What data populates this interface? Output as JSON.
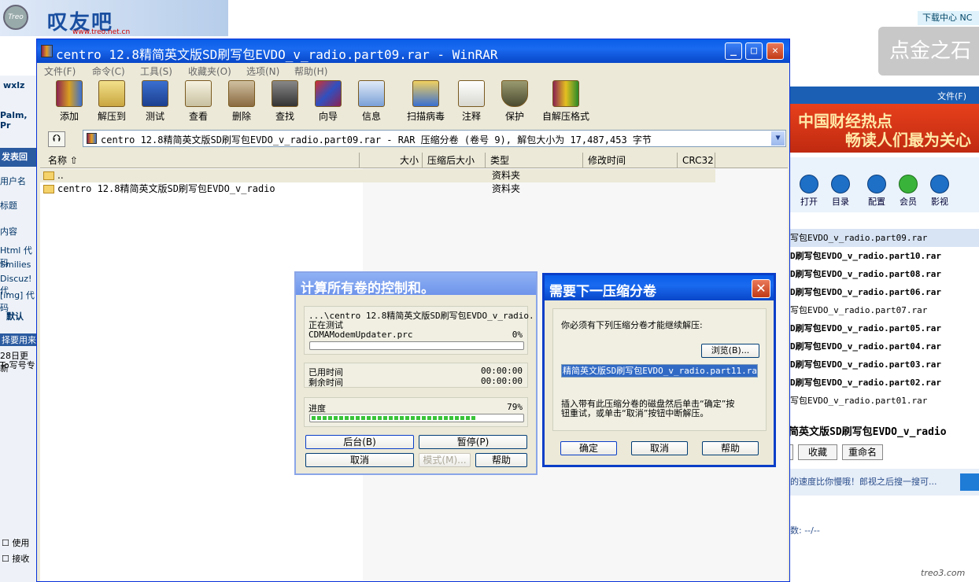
{
  "background": {
    "logo_badge": "Treo",
    "logo_text": "叹友吧",
    "logo_url": "www.treo.net.cn",
    "download_center": "下载中心 NC",
    "gold_stone": "点金之石",
    "left_user": "wxlz",
    "left_palm": "Palm, Pr",
    "left_post": "发表回",
    "left_labels": [
      "用户名",
      "标题",
      "内容",
      "Html 代码",
      "Smilies",
      "Discuz!代",
      "[img] 代码"
    ],
    "left_default": "默认",
    "left_select": "择要用来",
    "left_update": "28日更新",
    "left_write": "To写号专",
    "left_use": "使用",
    "left_receive": "接收",
    "right_file_menu": "文件(F)",
    "right_news": [
      "中国财经热点",
      "畅读人们最为关心"
    ],
    "right_tools": [
      "打开",
      "目录",
      "配置",
      "会员",
      "影视"
    ],
    "right_files": [
      "写包EVDO_v_radio.part09.rar",
      "D刷写包EVDO_v_radio.part10.rar",
      "D刷写包EVDO_v_radio.part08.rar",
      "D刷写包EVDO_v_radio.part06.rar",
      "写包EVDO_v_radio.part07.rar",
      "D刷写包EVDO_v_radio.part05.rar",
      "D刷写包EVDO_v_radio.part04.rar",
      "D刷写包EVDO_v_radio.part03.rar",
      "D刷写包EVDO_v_radio.part02.rar",
      "写包EVDO_v_radio.part01.rar"
    ],
    "right_big_title": "简英文版SD刷写包EVDO_v_radio",
    "right_btn_fav": "收藏",
    "right_btn_rename": "重命名",
    "right_ad": "的速度比你慢哦！郎视之后搜一搜可...",
    "right_count": "数: --/--",
    "watermark": "treo3.com"
  },
  "winrar": {
    "title": "centro 12.8精简英文版SD刷写包EVDO_v_radio.part09.rar - WinRAR",
    "menu": [
      "文件(F)",
      "命令(C)",
      "工具(S)",
      "收藏夹(O)",
      "选项(N)",
      "帮助(H)"
    ],
    "toolbar": [
      "添加",
      "解压到",
      "测试",
      "查看",
      "删除",
      "查找",
      "向导",
      "信息",
      "扫描病毒",
      "注释",
      "保护",
      "自解压格式"
    ],
    "path": "centro 12.8精简英文版SD刷写包EVDO_v_radio.part09.rar - RAR 压缩分卷 (卷号 9), 解包大小为 17,487,453 字节",
    "columns": [
      "名称",
      "大小",
      "压缩后大小",
      "类型",
      "修改时间",
      "CRC32"
    ],
    "rows": [
      {
        "name": "..",
        "type": "资料夹"
      },
      {
        "name": "centro 12.8精简英文版SD刷写包EVDO_v_radio",
        "type": "资料夹"
      }
    ]
  },
  "progress_dialog": {
    "title": "计算所有卷的控制和。",
    "archive": "...\\centro 12.8精简英文版SD刷写包EVDO_v_radio.",
    "testing": "正在测试",
    "file": "CDMAModemUpdater.prc",
    "file_percent": "0%",
    "file_progress": 0,
    "elapsed_label": "已用时间",
    "elapsed": "00:00:00",
    "remaining_label": "剩余时间",
    "remaining": "00:00:00",
    "progress_label": "进度",
    "progress_percent": "79%",
    "progress": 79,
    "btn_background": "后台(B)",
    "btn_pause": "暂停(P)",
    "btn_cancel": "取消",
    "btn_mode": "模式(M)...",
    "btn_help": "帮助"
  },
  "next_volume_dialog": {
    "title": "需要下一压缩分卷",
    "message": "你必须有下列压缩分卷才能继续解压:",
    "browse": "浏览(B)...",
    "volume": "精简英文版SD刷写包EVDO_v_radio.part11.rar",
    "instruction_1": "插入带有此压缩分卷的磁盘然后单击“确定”按",
    "instruction_2": "钮重试，或单击“取消”按钮中断解压。",
    "btn_ok": "确定",
    "btn_cancel": "取消",
    "btn_help": "帮助"
  }
}
